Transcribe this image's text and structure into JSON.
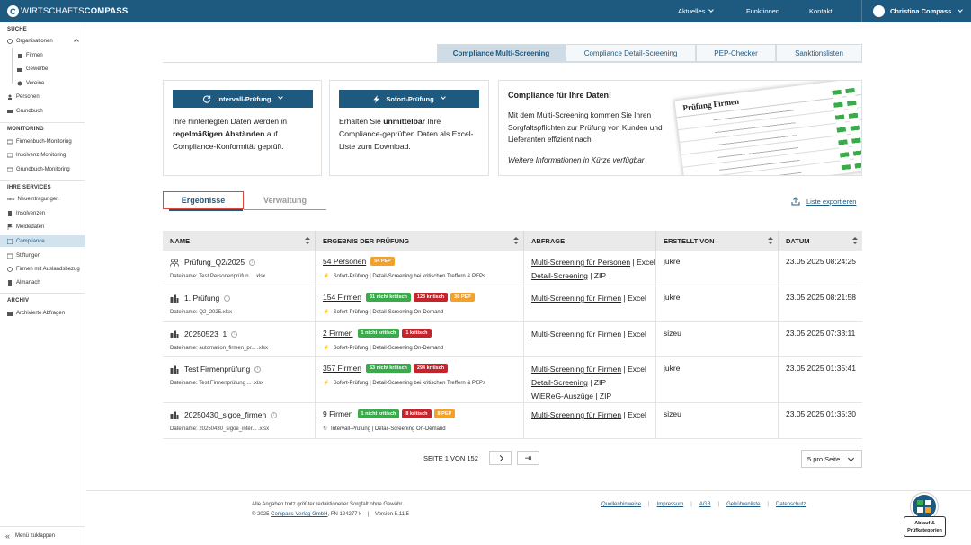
{
  "header": {
    "logo_light": "WIRTSCHAFTS",
    "logo_bold": "COMPASS",
    "nav": [
      "Aktuelles",
      "Funktionen",
      "Kontakt"
    ],
    "user": "Christina Compass"
  },
  "sidebar": {
    "suche": "SUCHE",
    "organisationen": "Organisationen",
    "firmen": "Firmen",
    "gewerbe": "Gewerbe",
    "vereine": "Vereine",
    "personen": "Personen",
    "grundbuch": "Grundbuch",
    "monitoring": "MONITORING",
    "fb_monitoring": "Firmenbuch-Monitoring",
    "ins_monitoring": "Insolvenz-Monitoring",
    "gb_monitoring": "Grundbuch-Monitoring",
    "services": "IHRE SERVICES",
    "neueintragungen": "Neueintragungen",
    "new_badge": "NEU",
    "insolvenzen": "Insolvenzen",
    "meldedaten": "Meldedaten",
    "compliance": "Compliance",
    "stiftungen": "Stiftungen",
    "auslandsbezug": "Firmen mit Auslandsbezug",
    "almanach": "Almanach",
    "archiv": "ARCHIV",
    "archivierte": "Archivierte Abfragen",
    "collapse": "Menü zuklappen"
  },
  "tabs": [
    "Compliance Multi-Screening",
    "Compliance Detail-Screening",
    "PEP-Checker",
    "Sanktionslisten"
  ],
  "cards": {
    "interval_btn": "Intervall-Prüfung",
    "interval_t1": "Ihre hinterlegten Daten werden in ",
    "interval_b": "regelmäßigen Abständen",
    "interval_t2": " auf Compliance-Konformität geprüft.",
    "instant_btn": "Sofort-Prüfung",
    "instant_t1": "Erhalten Sie ",
    "instant_b": "unmittelbar",
    "instant_t2": " Ihre Compliance-geprüften Daten als Excel-Liste zum Download.",
    "promo_title": "Compliance für Ihre Daten!",
    "promo_text": "Mit dem Multi-Screening kommen Sie Ihren Sorgfaltspflichten zur Prüfung von Kunden und Lieferanten effizient nach.",
    "promo_italic": "Weitere Informationen in Kürze verfügbar",
    "promo_sheet_title": "Prüfung Firmen"
  },
  "subtabs": {
    "active": "Ergebnisse",
    "inactive": "Verwaltung"
  },
  "export_label": "Liste exportieren",
  "table": {
    "headers": [
      "NAME",
      "ERGEBNIS DER PRÜFUNG",
      "ABFRAGE",
      "ERSTELLT VON",
      "DATUM"
    ],
    "rows": [
      {
        "name": "Prüfung_Q2/2025",
        "file": "Dateiname: Test Personenprüfun... .xlsx",
        "result": "54 Personen",
        "badges": [
          {
            "t": "54 PEP",
            "c": "o"
          }
        ],
        "sub": "Sofort-Prüfung | Detail-Screening bei kritischen Treffern & PEPs",
        "aq": [
          [
            "Multi-Screening für Personen",
            " | Excel"
          ],
          [
            "Detail-Screening",
            " | ZIP"
          ]
        ],
        "by": "jukre",
        "date": "23.05.2025 08:24:25"
      },
      {
        "name": "1. Prüfung",
        "file": "Dateiname: Q2_2025.xlsx",
        "result": "154 Firmen",
        "badges": [
          {
            "t": "31 nicht kritisch",
            "c": "g"
          },
          {
            "t": "123 kritisch",
            "c": "r"
          },
          {
            "t": "38 PEP",
            "c": "o"
          }
        ],
        "sub": "Sofort-Prüfung | Detail-Screening On-Demand",
        "aq": [
          [
            "Multi-Screening für Firmen",
            " | Excel"
          ]
        ],
        "by": "jukre",
        "date": "23.05.2025 08:21:58"
      },
      {
        "name": "20250523_1",
        "file": "Dateiname: automation_firmen_pr... .xlsx",
        "result": "2 Firmen",
        "badges": [
          {
            "t": "1 nicht kritisch",
            "c": "g"
          },
          {
            "t": "1 kritisch",
            "c": "r"
          }
        ],
        "sub": "Sofort-Prüfung | Detail-Screening On-Demand",
        "aq": [
          [
            "Multi-Screening für Firmen",
            " | Excel"
          ]
        ],
        "by": "sizeu",
        "date": "23.05.2025 07:33:11"
      },
      {
        "name": "Test Firmenprüfung",
        "file": "Dateiname: Test Firmenprüfung ... .xlsx",
        "result": "357 Firmen",
        "badges": [
          {
            "t": "63 nicht kritisch",
            "c": "g"
          },
          {
            "t": "294 kritisch",
            "c": "r"
          }
        ],
        "sub": "Sofort-Prüfung | Detail-Screening bei kritischen Treffern & PEPs",
        "aq": [
          [
            "Multi-Screening für Firmen",
            " | Excel"
          ],
          [
            "Detail-Screening",
            " | ZIP"
          ],
          [
            "WiEReG-Auszüge ",
            " | ZIP"
          ]
        ],
        "by": "jukre",
        "date": "23.05.2025 01:35:41"
      },
      {
        "name": "20250430_sigoe_firmen",
        "file": "Dateiname: 20250430_sigoe_inter... .xlsx",
        "result": "9 Firmen",
        "badges": [
          {
            "t": "1 nicht kritisch",
            "c": "g"
          },
          {
            "t": "8 kritisch",
            "c": "r"
          },
          {
            "t": "8 PEP",
            "c": "o"
          }
        ],
        "sub": "Intervall-Prüfung | Detail-Screening On-Demand",
        "aq": [
          [
            "Multi-Screening für Firmen",
            " | Excel"
          ]
        ],
        "by": "sizeu",
        "date": "23.05.2025 01:35:30"
      }
    ]
  },
  "pager": {
    "label": "SEITE 1 VON 152",
    "perpage": "5 pro Seite"
  },
  "footer": {
    "line1": "Alle Angaben trotz größter redaktioneller Sorgfalt ohne Gewähr.",
    "copy": "© 2025 ",
    "company": "Compass-Verlag GmbH",
    "rest": ", FN 124277 k    |    Version 5.11.5",
    "links": [
      "Quellenhinweise",
      "Impressum",
      "AGB",
      "Gebührenliste",
      "Datenschutz"
    ]
  },
  "help": {
    "line1": "Ablauf &",
    "line2": "Prüfkategorien"
  }
}
